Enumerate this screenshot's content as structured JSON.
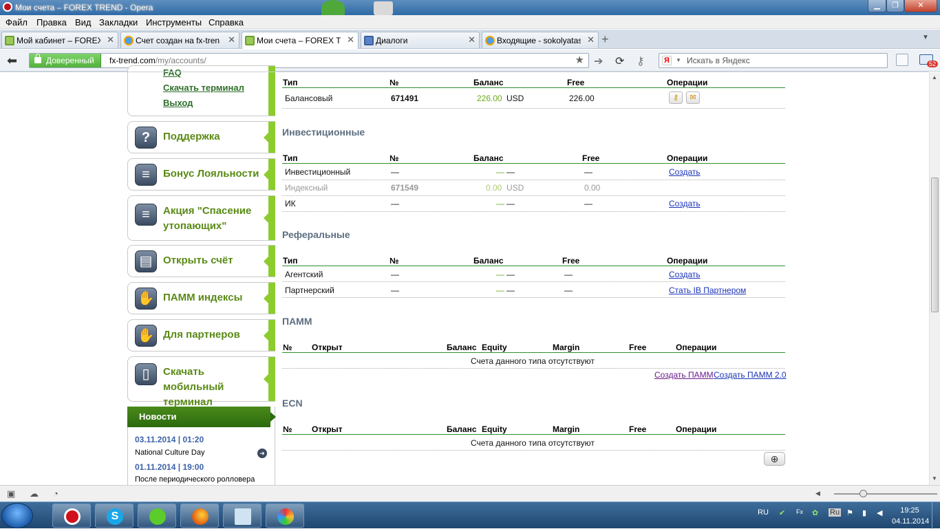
{
  "window": {
    "title": "Мои счета – FOREX TREND - Opera"
  },
  "menu": [
    "Файл",
    "Правка",
    "Вид",
    "Закладки",
    "Инструменты",
    "Справка"
  ],
  "tabs": [
    {
      "label": "Мой кабинет – FOREX ...",
      "icon": "fx-icon",
      "active": false
    },
    {
      "label": "Счет создан на fx-tren...",
      "icon": "mail-icon",
      "active": false
    },
    {
      "label": "Мои счета – FOREX TR...",
      "icon": "fx-icon",
      "active": true
    },
    {
      "label": "Диалоги",
      "icon": "dialog-icon",
      "active": false
    },
    {
      "label": "Входящие - sokolyatas...",
      "icon": "mail-icon",
      "active": false
    }
  ],
  "address": {
    "trusted": "Доверенный",
    "host": "fx-trend.com",
    "path": "/my/accounts/"
  },
  "search": {
    "placeholder": "Искать в Яндекс"
  },
  "mail_badge": "52",
  "sidebar": {
    "top_links": [
      "FAQ",
      "Скачать терминал",
      "Выход"
    ],
    "items": [
      {
        "label": "Поддержка",
        "icon": "question-icon"
      },
      {
        "label": "Бонус Лояльности",
        "icon": "coins-icon"
      },
      {
        "label": "Акция \"Спасение утопающих\"",
        "label2": "утопающих\"",
        "icon": "coins-icon"
      },
      {
        "label": "Открыть счёт",
        "icon": "card-icon"
      },
      {
        "label": "ПАММ индексы",
        "icon": "handshake-icon"
      },
      {
        "label": "Для партнеров",
        "icon": "handshake-icon"
      },
      {
        "label": "Скачать мобильный терминал",
        "icon": "phone-icon"
      }
    ],
    "news": {
      "title": "Новости",
      "entries": [
        {
          "date": "03.11.2014",
          "time": "01:20",
          "text": "National Culture Day"
        },
        {
          "date": "01.11.2014",
          "time": "19:00",
          "text": "После периодического ролловера"
        }
      ]
    }
  },
  "balance": {
    "headers": [
      "Тип",
      "№",
      "Баланс",
      "Free",
      "Операции"
    ],
    "rows": [
      {
        "type": "Балансовый",
        "num": "671491",
        "balance": "226.00",
        "currency": "USD",
        "free": "226.00"
      }
    ]
  },
  "invest": {
    "title": "Инвестиционные",
    "headers": [
      "Тип",
      "№",
      "Баланс",
      "Free",
      "Операции"
    ],
    "rows": [
      {
        "type": "Инвестиционный",
        "num": "—",
        "balance": "—",
        "currency": "—",
        "free": "—",
        "op": "Создать"
      },
      {
        "type": "Индексный",
        "num": "671549",
        "balance": "0.00",
        "currency": "USD",
        "free": "0.00",
        "op": ""
      },
      {
        "type": "ИК",
        "num": "—",
        "balance": "—",
        "currency": "—",
        "free": "—",
        "op": "Создать"
      }
    ]
  },
  "referral": {
    "title": "Реферальные",
    "headers": [
      "Тип",
      "№",
      "Баланс",
      "Free",
      "Операции"
    ],
    "rows": [
      {
        "type": "Агентский",
        "num": "—",
        "balance": "—",
        "currency": "—",
        "free": "—",
        "op": "Создать"
      },
      {
        "type": "Партнерский",
        "num": "—",
        "balance": "—",
        "currency": "—",
        "free": "—",
        "op": "Стать IB Партнером"
      }
    ]
  },
  "pamm": {
    "title": "ПАММ",
    "headers": [
      "№",
      "Открыт",
      "Баланс",
      "Equity",
      "Margin",
      "Free",
      "Операции"
    ],
    "empty": "Счета данного типа отсутствуют",
    "links": [
      "Создать ПАММ",
      "Создать ПАММ 2.0"
    ]
  },
  "ecn": {
    "title": "ECN",
    "headers": [
      "№",
      "Открыт",
      "Баланс",
      "Equity",
      "Margin",
      "Free",
      "Операции"
    ],
    "empty": "Счета данного типа отсутствуют"
  },
  "taskbar": {
    "lang": "RU",
    "time": "19:25",
    "date": "04.11.2014"
  }
}
